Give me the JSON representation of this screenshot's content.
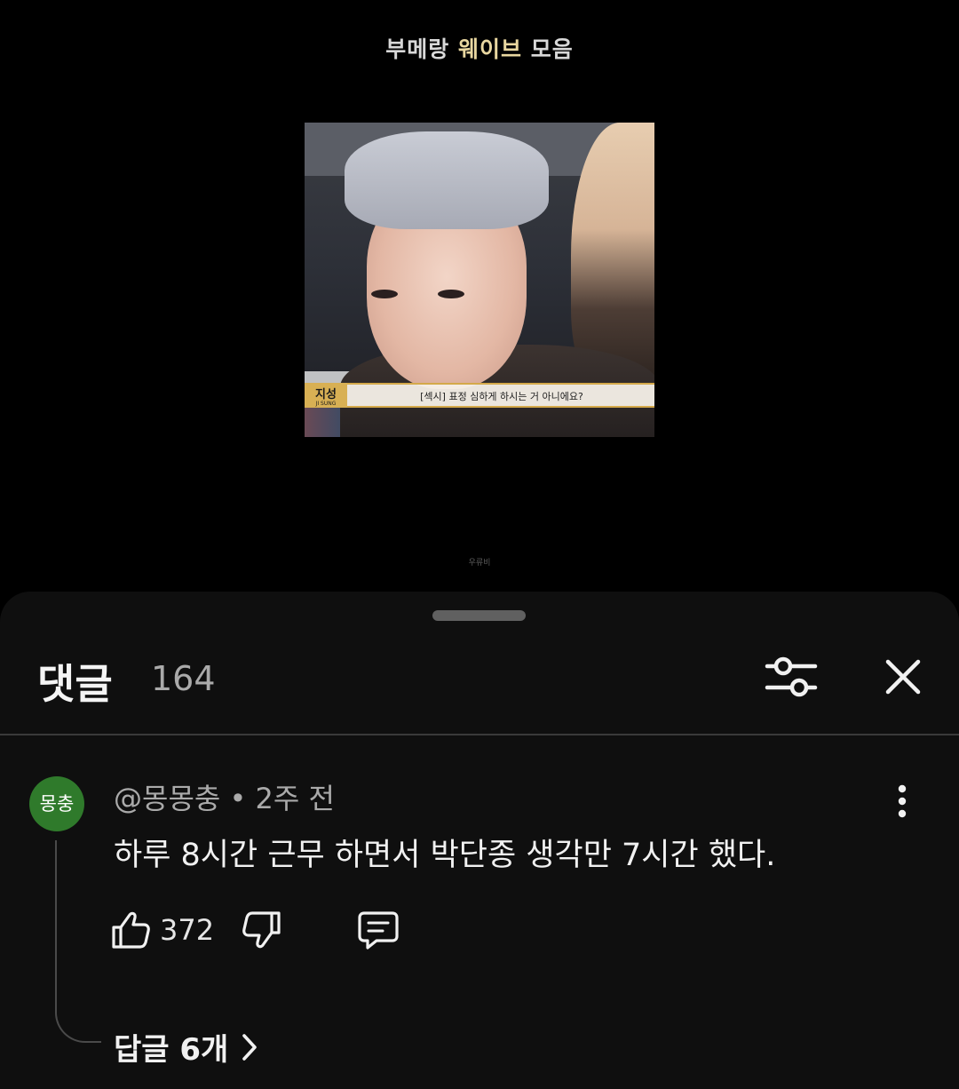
{
  "video": {
    "title_part1": "부메랑 ",
    "title_highlight": "웨이브",
    "title_part2": " 모음",
    "caption_name": "지성",
    "caption_name_sub": "JI SUNG",
    "caption_text": "[섹시] 표정 심하게 하시는 거 아니에요?",
    "watermark": "우류비"
  },
  "comments_sheet": {
    "title": "댓글",
    "count": "164",
    "filter_icon": "sliders-icon",
    "close_icon": "close-icon"
  },
  "comment": {
    "avatar_text": "몽충",
    "avatar_color": "#2f7a2b",
    "author": "@몽몽충",
    "separator": " • ",
    "time": "2주 전",
    "text": "하루 8시간 근무 하면서 박단종 생각만 7시간 했다.",
    "likes": "372",
    "replies_label": "답글 6개"
  },
  "colors": {
    "background": "#000000",
    "sheet": "#0f0f0f",
    "title_highlight": "#e9d7a0",
    "secondary_text": "#aaaaaa"
  }
}
